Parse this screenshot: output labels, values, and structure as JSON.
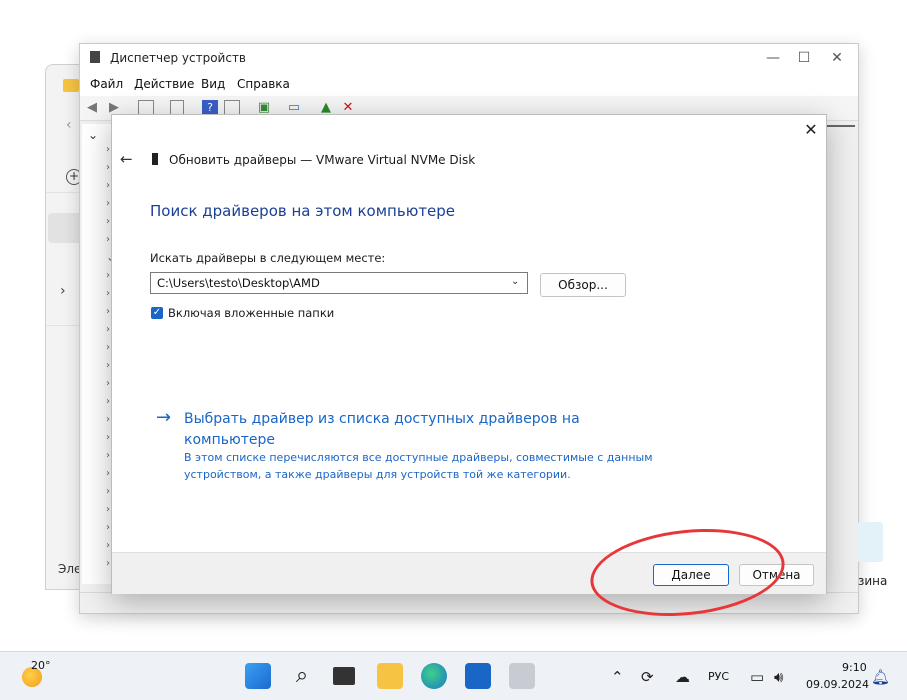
{
  "explorer": {
    "footer_label": "Эле"
  },
  "device_manager": {
    "title": "Диспетчер устройств",
    "menu": [
      "Файл",
      "Действие",
      "Вид",
      "Справка"
    ],
    "window_controls": {
      "minimize": "—",
      "maximize": "☐",
      "close": "✕"
    }
  },
  "dialog": {
    "close_glyph": "✕",
    "back_glyph": "←",
    "title": "Обновить драйверы — VMware Virtual NVMe Disk",
    "heading": "Поиск драйверов на этом компьютере",
    "search_label": "Искать драйверы в следующем месте:",
    "path_value": "C:\\Users\\testo\\Desktop\\AMD",
    "browse_label": "Обзор...",
    "include_subfolders_label": "Включая вложенные папки",
    "include_subfolders_checked": true,
    "pick_link": "Выбрать драйвер из списка доступных драйверов на компьютере",
    "pick_description": "В этом списке перечисляются все доступные драйверы, совместимые с данным устройством, а также драйверы для устройств той же категории.",
    "next_label": "Далее",
    "cancel_label": "Отмена"
  },
  "desktop": {
    "recycle_bin_label": "зина"
  },
  "taskbar": {
    "weather_temp": "20°",
    "language": "РУС",
    "time": "9:10",
    "date": "09.09.2024"
  },
  "colors": {
    "accent": "#1a66c6",
    "heading": "#1a3f96",
    "annotation": "#e8373b"
  }
}
